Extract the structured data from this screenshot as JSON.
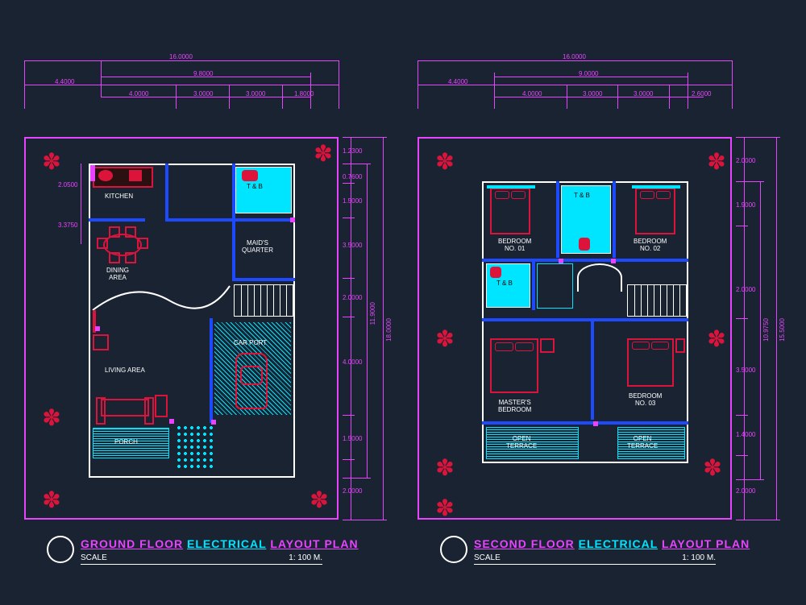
{
  "ground": {
    "title_l": "GROUND FLOOR",
    "title_m": "ELECTRICAL",
    "title_r": "LAYOUT PLAN",
    "scale_label": "SCALE",
    "scale_value": "1: 100 M.",
    "dims_top": {
      "total": "16.0000",
      "a": "4.4000",
      "sub_total": "9.8000",
      "b": "4.0000",
      "c": "3.0000",
      "d": "3.0000",
      "e": "1.8000"
    },
    "dims_right": {
      "overall": "18.0000",
      "sub": "11.9000",
      "a": "1.2300",
      "b": "0.7600",
      "c": "1.5000",
      "d": "3.5000",
      "e": "2.0000",
      "f": "4.0000",
      "g": "1.5000",
      "h": "2.0000"
    },
    "dims_left": {
      "a": "2.0500",
      "b": "3.3750"
    },
    "rooms": {
      "kitchen": "KITCHEN",
      "dining": "DINING\nAREA",
      "tb": "T & B",
      "maid": "MAID'S\nQUARTER",
      "living": "LIVING AREA",
      "carport": "CAR PORT",
      "porch": "PORCH"
    }
  },
  "second": {
    "title_l": "SECOND FLOOR",
    "title_m": "ELECTRICAL",
    "title_r": "LAYOUT PLAN",
    "scale_label": "SCALE",
    "scale_value": "1: 100 M.",
    "dims_top": {
      "total": "16.0000",
      "a": "4.4000",
      "sub_total": "9.0000",
      "b": "4.0000",
      "c": "3.0000",
      "d": "3.0000",
      "e": "2.6000"
    },
    "dims_right": {
      "overall": "15.5000",
      "sub": "10.9750",
      "a": "2.0000",
      "b": "1.9000",
      "c": "2.0000",
      "d": "3.5000",
      "e": "1.4000",
      "f": "2.0000"
    },
    "rooms": {
      "bedroom1": "BEDROOM\nNO. 01",
      "tb1": "T & B",
      "bedroom2": "BEDROOM\nNO. 02",
      "tb2": "T & B",
      "master": "MASTER'S\nBEDROOM",
      "bedroom3": "BEDROOM\nNO. 03",
      "terrace1": "OPEN\nTERRACE",
      "terrace2": "OPEN\nTERRACE"
    }
  }
}
